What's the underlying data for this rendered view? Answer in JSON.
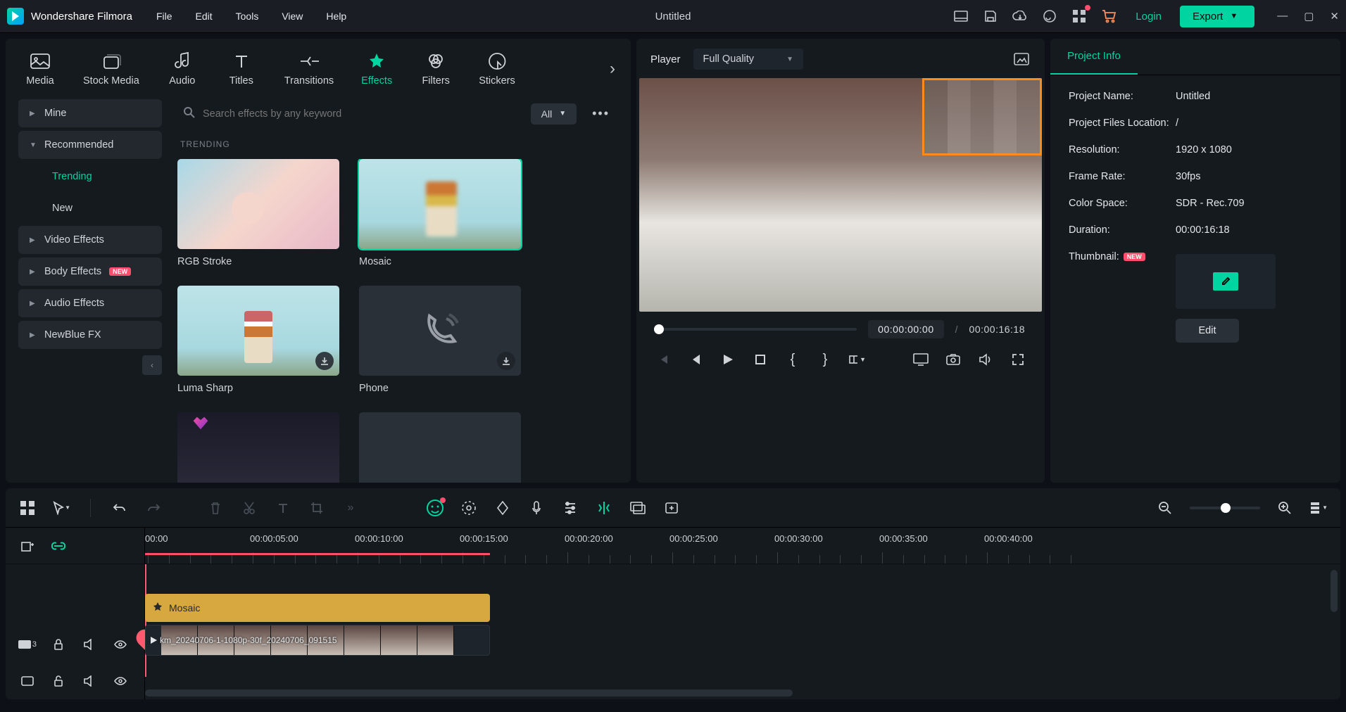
{
  "app_name": "Wondershare Filmora",
  "menu": [
    "File",
    "Edit",
    "Tools",
    "View",
    "Help"
  ],
  "document_title": "Untitled",
  "login_label": "Login",
  "export_label": "Export",
  "top_tabs": [
    "Media",
    "Stock Media",
    "Audio",
    "Titles",
    "Transitions",
    "Effects",
    "Filters",
    "Stickers"
  ],
  "active_tab": "Effects",
  "search_placeholder": "Search effects by any keyword",
  "filter_all": "All",
  "sidebar": {
    "mine": "Mine",
    "recommended": "Recommended",
    "trending": "Trending",
    "new": "New",
    "video_effects": "Video Effects",
    "body_effects": "Body Effects",
    "audio_effects": "Audio Effects",
    "newblue": "NewBlue FX",
    "new_badge": "NEW"
  },
  "section_trending": "TRENDING",
  "effects": [
    {
      "name": "RGB Stroke",
      "thumb": "th-rgb"
    },
    {
      "name": "Mosaic",
      "thumb": "th-mosaic",
      "selected": true
    },
    {
      "name": "Luma Sharp",
      "thumb": "th-luma",
      "dl": true
    },
    {
      "name": "Phone",
      "thumb": "th-phone",
      "dl": true
    }
  ],
  "player": {
    "label": "Player",
    "quality": "Full Quality",
    "time_current": "00:00:00:00",
    "time_total": "00:00:16:18",
    "sep": "/"
  },
  "project_info": {
    "tab": "Project Info",
    "name_label": "Project Name:",
    "name_value": "Untitled",
    "files_label": "Project Files Location:",
    "files_value": "/",
    "res_label": "Resolution:",
    "res_value": "1920 x 1080",
    "fps_label": "Frame Rate:",
    "fps_value": "30fps",
    "cs_label": "Color Space:",
    "cs_value": "SDR - Rec.709",
    "dur_label": "Duration:",
    "dur_value": "00:00:16:18",
    "thumb_label": "Thumbnail:",
    "new_badge": "NEW",
    "edit": "Edit"
  },
  "timeline": {
    "ruler": [
      "00:00",
      "00:00:05:00",
      "00:00:10:00",
      "00:00:15:00",
      "00:00:20:00",
      "00:00:25:00",
      "00:00:30:00",
      "00:00:35:00",
      "00:00:40:00"
    ],
    "effect_clip": "Mosaic",
    "clip_name": "km_20240706-1-1080p-30f_20240706_091515",
    "track_count": "3"
  }
}
